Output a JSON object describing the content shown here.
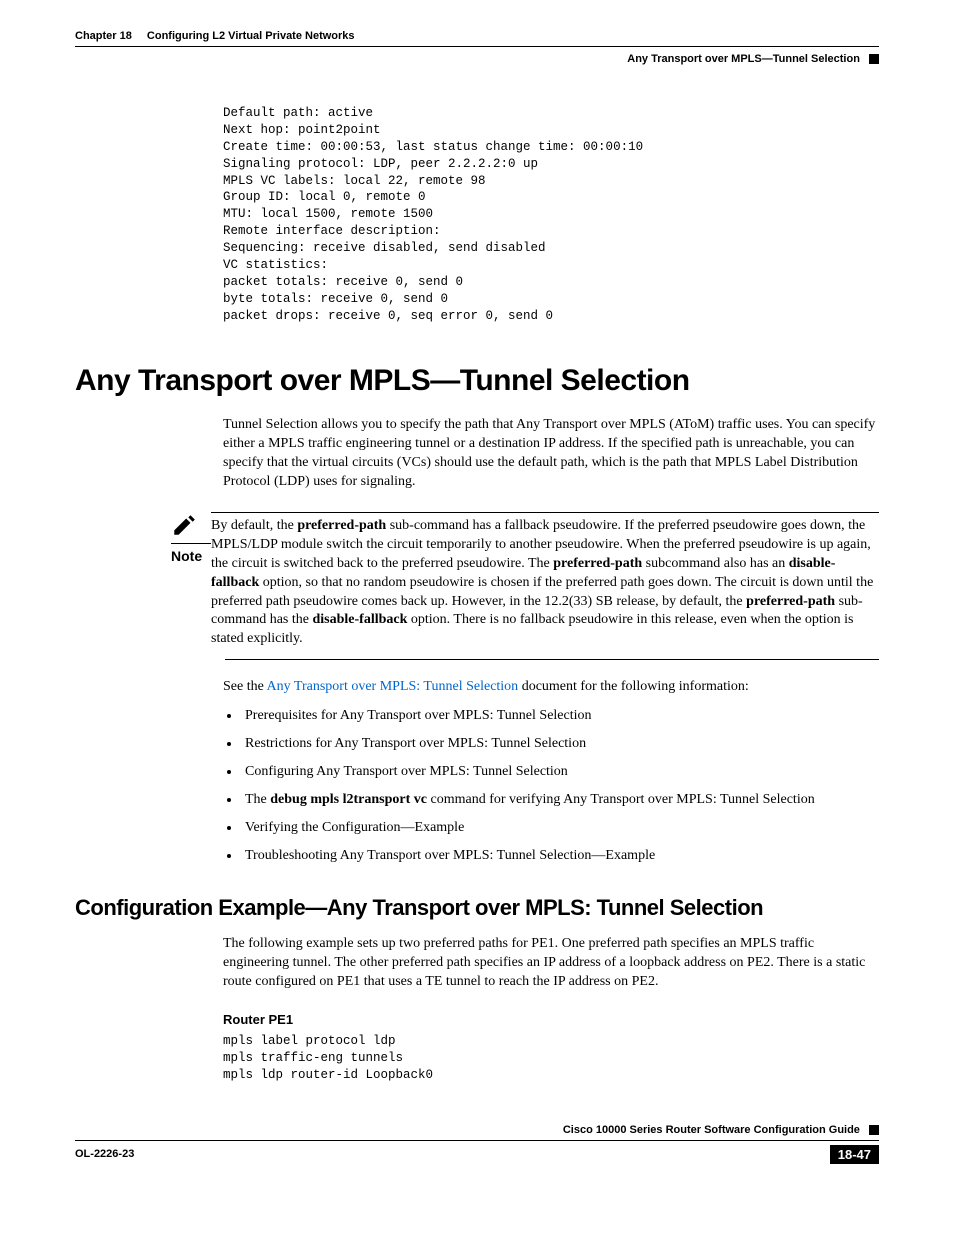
{
  "header": {
    "chapter_num": "Chapter 18",
    "chapter_title": "Configuring L2 Virtual Private Networks",
    "section": "Any Transport over MPLS—Tunnel Selection"
  },
  "code1": "Default path: active\nNext hop: point2point\nCreate time: 00:00:53, last status change time: 00:00:10\nSignaling protocol: LDP, peer 2.2.2.2:0 up\nMPLS VC labels: local 22, remote 98\nGroup ID: local 0, remote 0\nMTU: local 1500, remote 1500\nRemote interface description:\nSequencing: receive disabled, send disabled\nVC statistics:\npacket totals: receive 0, send 0\nbyte totals: receive 0, send 0\npacket drops: receive 0, seq error 0, send 0",
  "h1": "Any Transport over MPLS—Tunnel Selection",
  "intro": "Tunnel Selection allows you to specify the path that Any Transport over MPLS (AToM) traffic uses. You can specify either a MPLS traffic engineering tunnel or a destination IP address. If the specified path is unreachable, you can specify that the virtual circuits (VCs) should use the default path, which is the path that MPLS Label Distribution Protocol (LDP) uses for signaling.",
  "note": {
    "label": "Note",
    "t1": "By default, the ",
    "b1": "preferred-path",
    "t2": " sub-command has a fallback pseudowire. If the preferred pseudowire goes down, the MPLS/LDP module switch the circuit temporarily to another pseudowire. When the preferred pseudowire is up again, the circuit is switched back to the preferred pseudowire. The ",
    "b2": "preferred-path",
    "t3": " subcommand also has an ",
    "b3": "disable-fallback",
    "t4": " option, so that no random pseudowire is chosen if the preferred path goes down. The circuit is down until the preferred path pseudowire comes back up. However, in the 12.2(33) SB release, by default, the ",
    "b4": "preferred-path",
    "t5": " sub-command has the ",
    "b5": "disable-fallback",
    "t6": " option. There is no fallback pseudowire in this release, even when the option is stated explicitly."
  },
  "see": {
    "t1": "See the ",
    "link": "Any Transport over MPLS: Tunnel Selection",
    "t2": " document for the following information:"
  },
  "bullets": {
    "i0": "Prerequisites for Any Transport over MPLS: Tunnel Selection",
    "i1": "Restrictions for Any Transport over MPLS: Tunnel Selection",
    "i2": "Configuring Any Transport over MPLS: Tunnel Selection",
    "i3a": "The ",
    "i3b": "debug mpls l2transport vc",
    "i3c": " command for verifying Any Transport over MPLS: Tunnel Selection",
    "i4": "Verifying the Configuration—Example",
    "i5": "Troubleshooting Any Transport over MPLS: Tunnel Selection—Example"
  },
  "h2": "Configuration Example—Any Transport over MPLS: Tunnel Selection",
  "example_text": "The following example sets up two preferred paths for PE1. One preferred path specifies an MPLS traffic engineering tunnel. The other preferred path specifies an IP address of a loopback address on PE2. There is a static route configured on PE1 that uses a TE tunnel to reach the IP address on PE2.",
  "router_label": "Router PE1",
  "code2": "mpls label protocol ldp\nmpls traffic-eng tunnels\nmpls ldp router-id Loopback0",
  "footer": {
    "guide": "Cisco 10000 Series Router Software Configuration Guide",
    "docid": "OL-2226-23",
    "page": "18-47"
  }
}
